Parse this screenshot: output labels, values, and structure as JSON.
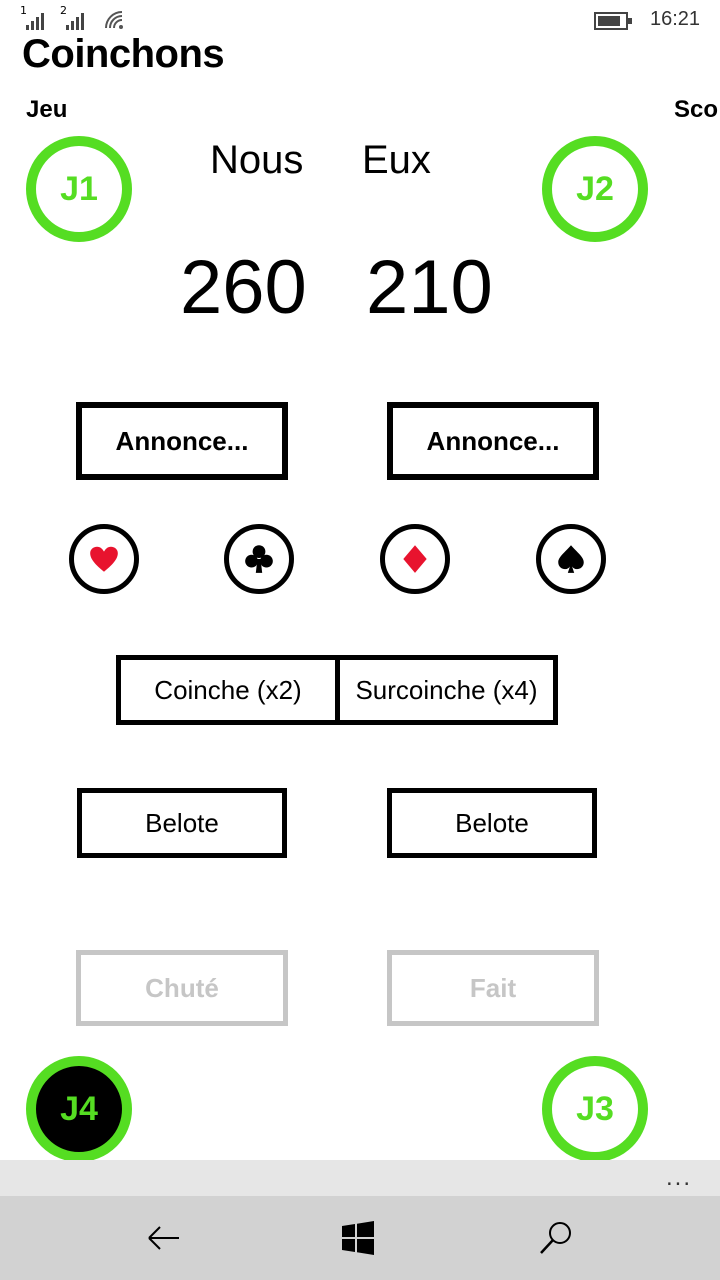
{
  "status": {
    "sim1": "1",
    "sim2": "2",
    "time": "16:21",
    "icons": [
      "signal-icon",
      "signal-icon",
      "wifi-icon",
      "battery-icon"
    ]
  },
  "app": {
    "title": "Coinchons"
  },
  "pivot": {
    "left": "Jeu",
    "right": "Sco"
  },
  "players": {
    "j1": "J1",
    "j2": "J2",
    "j3": "J3",
    "j4": "J4",
    "active": "J4"
  },
  "teams": {
    "us": "Nous",
    "them": "Eux"
  },
  "scores": {
    "us": "260",
    "them": "210"
  },
  "buttons": {
    "announce_us": "Annonce...",
    "announce_them": "Annonce...",
    "coinche": "Coinche (x2)",
    "surcoinche": "Surcoinche (x4)",
    "belote_us": "Belote",
    "belote_them": "Belote",
    "chute": "Chuté",
    "fait": "Fait"
  },
  "suits": [
    "heart-icon",
    "club-icon",
    "diamond-icon",
    "spade-icon"
  ],
  "app_bar": {
    "more": "..."
  },
  "colors": {
    "player_ring": "#55dd22",
    "red_suit": "#e8132e",
    "disabled": "#c6c6c6"
  }
}
